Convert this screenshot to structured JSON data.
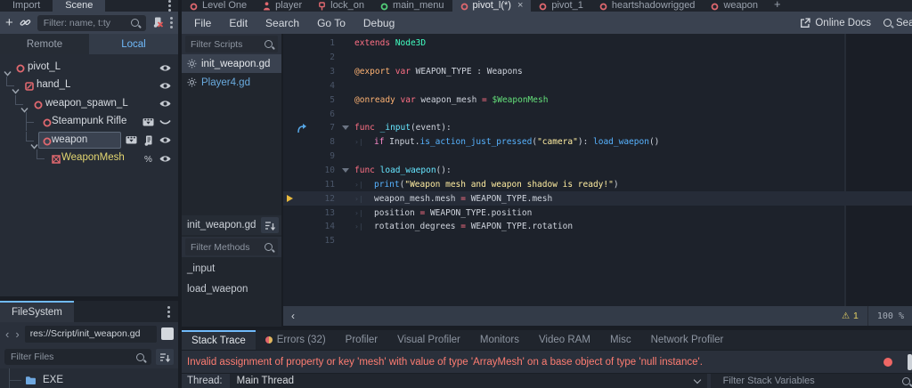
{
  "colors": {
    "accent": "#70bafa",
    "error_text": "#ff7d72",
    "warning": "#e3cf63",
    "keyword": "#ff7085",
    "control_flow": "#ff8ccc",
    "annotation": "#ffb373",
    "engine_type": "#42ffc2",
    "node_reference": "#64e07a",
    "function_definition": "#66e6ff",
    "function_call": "#57b3ff",
    "string": "#ffeda1",
    "node_icon_red": "#e0686f",
    "scene_icon_green": "#53cf79"
  },
  "icons": {
    "add_node": "+",
    "history_back": "‹",
    "history_forward": "›",
    "scroll_left": "‹",
    "warning_triangle": "⚠",
    "close_tab": "×",
    "percent": "%",
    "tab_marker": "›|"
  },
  "left_dock": {
    "tabs": [
      {
        "label": "Import"
      },
      {
        "label": "Scene"
      }
    ],
    "toolbar": {
      "filter_placeholder": "Filter: name, t:ty"
    },
    "view_tabs": [
      {
        "label": "Remote"
      },
      {
        "label": "Local"
      }
    ],
    "tree": [
      {
        "name": "pivot_L",
        "icon": "node3d",
        "depth": 0,
        "arrow": true,
        "right": [
          "eye"
        ]
      },
      {
        "name": "hand_L",
        "icon": "bone",
        "depth": 1,
        "arrow": true,
        "right": [
          "eye"
        ]
      },
      {
        "name": "weapon_spawn_L",
        "icon": "node3d",
        "depth": 2,
        "arrow": true,
        "right": [
          "eye"
        ]
      },
      {
        "name": "Steampunk Rifle",
        "icon": "node3d",
        "depth": 3,
        "arrow": false,
        "right": [
          "instance",
          "eye-closed"
        ]
      },
      {
        "name": "weapon",
        "icon": "node3d",
        "depth": 3,
        "arrow": true,
        "selected": true,
        "right": [
          "instance",
          "script",
          "eye"
        ]
      },
      {
        "name": "WeaponMesh",
        "icon": "mesh",
        "depth": 4,
        "arrow": false,
        "label_color": "#e3d671",
        "right": [
          "percent",
          "eye"
        ]
      }
    ]
  },
  "filesystem": {
    "tab_label": "FileSystem",
    "path": "res://Script/init_weapon.gd",
    "filter_placeholder": "Filter Files",
    "folders": [
      "EXE"
    ]
  },
  "scene_tabs": {
    "tabs": [
      {
        "label": "Level One",
        "icon": "scene-3d"
      },
      {
        "label": "player",
        "icon": "character"
      },
      {
        "label": "lock_on",
        "icon": "pin"
      },
      {
        "label": "main_menu",
        "icon": "scene-ui"
      },
      {
        "label": "pivot_l(*)",
        "icon": "scene-3d",
        "active": true,
        "close": true
      },
      {
        "label": "pivot_1",
        "icon": "scene-3d"
      },
      {
        "label": "heartshadowrigged",
        "icon": "scene-3d"
      },
      {
        "label": "weapon",
        "icon": "scene-3d"
      }
    ],
    "add_label": "+"
  },
  "menu": {
    "items": [
      "File",
      "Edit",
      "Search",
      "Go To",
      "Debug"
    ],
    "online_docs": "Online Docs",
    "search_help": "Search Help"
  },
  "script_panel": {
    "filter_scripts_placeholder": "Filter Scripts",
    "scripts": [
      {
        "name": "init_weapon.gd",
        "selected": true
      },
      {
        "name": "Player4.gd",
        "accent": true
      }
    ],
    "current_script": "init_weapon.gd",
    "filter_methods_placeholder": "Filter Methods",
    "methods": [
      "_input",
      "load_waepon"
    ]
  },
  "editor": {
    "status": {
      "scroll_left": "‹",
      "warning_count": "1",
      "zoom": "100 %"
    },
    "lines": [
      {
        "n": 1,
        "tokens": [
          [
            "kw",
            "extends"
          ],
          [
            "pl",
            " "
          ],
          [
            "type",
            "Node3D"
          ]
        ]
      },
      {
        "n": 2,
        "tokens": []
      },
      {
        "n": 3,
        "tokens": [
          [
            "ann",
            "@export"
          ],
          [
            "pl",
            " "
          ],
          [
            "kw",
            "var"
          ],
          [
            "pl",
            " WEAPON_TYPE : Weapons"
          ]
        ]
      },
      {
        "n": 4,
        "tokens": []
      },
      {
        "n": 5,
        "tokens": [
          [
            "ann",
            "@onready"
          ],
          [
            "pl",
            " "
          ],
          [
            "kw",
            "var"
          ],
          [
            "pl",
            " weapon_mesh "
          ],
          [
            "op",
            "="
          ],
          [
            "pl",
            " "
          ],
          [
            "node",
            "$WeaponMesh"
          ]
        ]
      },
      {
        "n": 6,
        "tokens": []
      },
      {
        "n": 7,
        "fold": true,
        "conn": true,
        "tokens": [
          [
            "kw",
            "func"
          ],
          [
            "pl",
            " "
          ],
          [
            "fdef",
            "_input"
          ],
          [
            "pl",
            "(event):"
          ]
        ]
      },
      {
        "n": 8,
        "indent": 1,
        "tokens": [
          [
            "ctrl",
            "if"
          ],
          [
            "pl",
            " Input."
          ],
          [
            "fcall",
            "is_action_just_pressed"
          ],
          [
            "pl",
            "("
          ],
          [
            "str",
            "\"camera\""
          ],
          [
            "pl",
            "): "
          ],
          [
            "fcall",
            "load_waepon"
          ],
          [
            "pl",
            "()"
          ]
        ]
      },
      {
        "n": 9,
        "tokens": []
      },
      {
        "n": 10,
        "fold": true,
        "tokens": [
          [
            "kw",
            "func"
          ],
          [
            "pl",
            " "
          ],
          [
            "fdef",
            "load_waepon"
          ],
          [
            "pl",
            "():"
          ]
        ]
      },
      {
        "n": 11,
        "indent": 1,
        "tokens": [
          [
            "fcall",
            "print"
          ],
          [
            "pl",
            "("
          ],
          [
            "str",
            "\"Weapon mesh and weapon shadow is ready!\""
          ],
          [
            "pl",
            ")"
          ]
        ]
      },
      {
        "n": 12,
        "indent": 1,
        "exec": true,
        "highlight": true,
        "tokens": [
          [
            "pl",
            "weapon_mesh.mesh "
          ],
          [
            "op",
            "="
          ],
          [
            "pl",
            " WEAPON_TYPE.mesh"
          ]
        ]
      },
      {
        "n": 13,
        "indent": 1,
        "tokens": [
          [
            "pl",
            "position "
          ],
          [
            "op",
            "="
          ],
          [
            "pl",
            " WEAPON_TYPE.position"
          ]
        ]
      },
      {
        "n": 14,
        "indent": 1,
        "tokens": [
          [
            "pl",
            "rotation_degrees "
          ],
          [
            "op",
            "="
          ],
          [
            "pl",
            " WEAPON_TYPE.rotation"
          ]
        ]
      },
      {
        "n": 15,
        "tokens": []
      }
    ]
  },
  "debugger": {
    "tabs": [
      {
        "label": "Stack Trace",
        "active": true
      },
      {
        "label": "Errors (32)",
        "dot": true
      },
      {
        "label": "Profiler"
      },
      {
        "label": "Visual Profiler"
      },
      {
        "label": "Monitors"
      },
      {
        "label": "Video RAM"
      },
      {
        "label": "Misc"
      },
      {
        "label": "Network Profiler"
      }
    ],
    "error_message": "Invalid assignment of property or key 'mesh' with value of type 'ArrayMesh' on a base object of type 'null instance'.",
    "thread_label": "Thread:",
    "thread_value": "Main Thread",
    "filter_placeholder": "Filter Stack Variables"
  }
}
